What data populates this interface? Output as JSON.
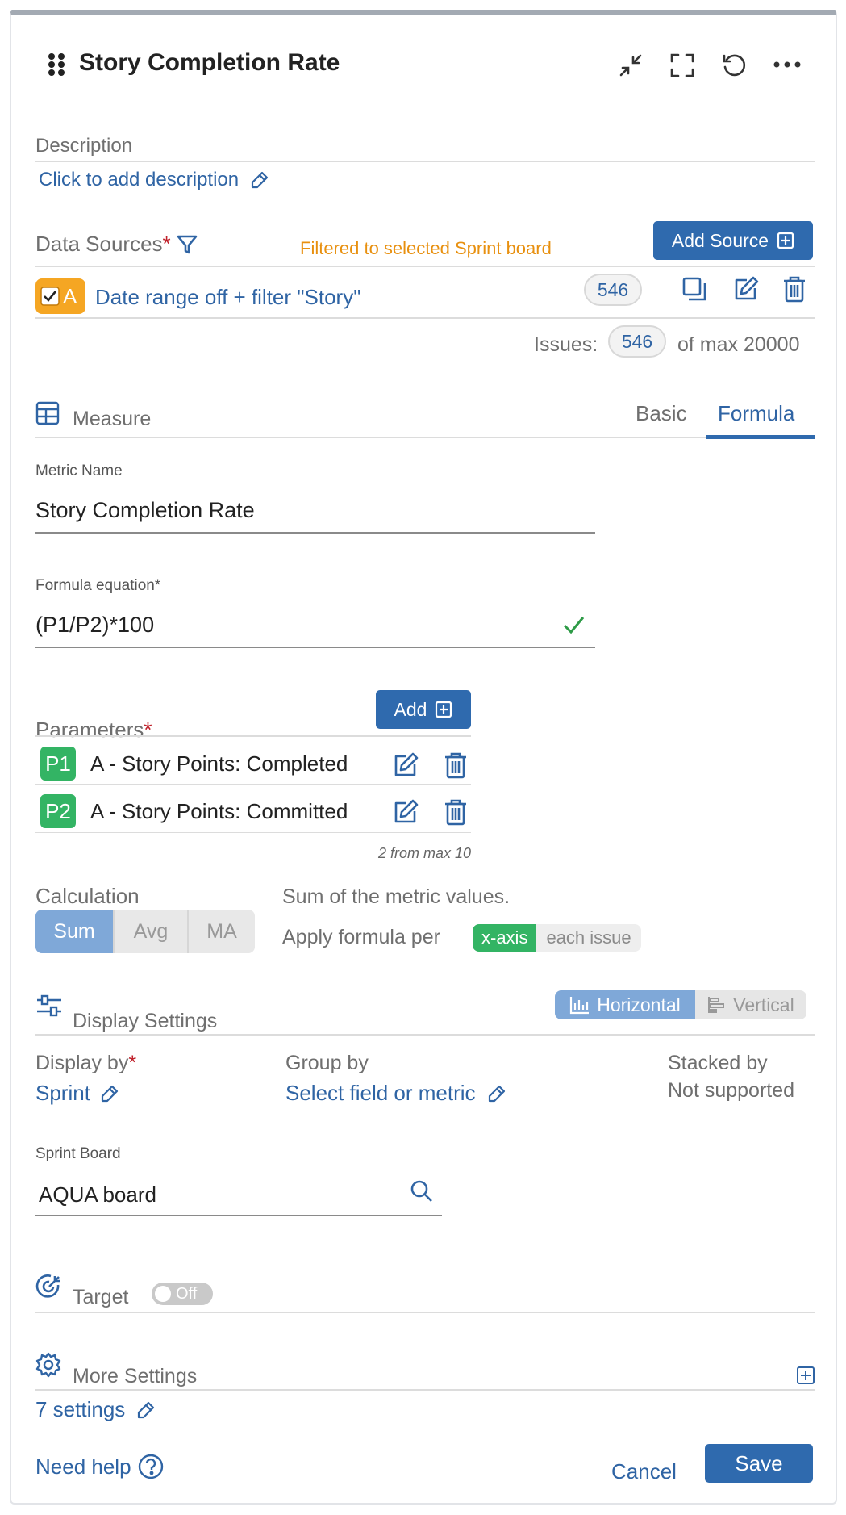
{
  "header": {
    "title": "Story Completion Rate"
  },
  "description": {
    "label": "Description",
    "link": "Click to add description"
  },
  "data_sources": {
    "label": "Data Sources",
    "required_mark": "*",
    "filter_note": "Filtered to selected Sprint board",
    "add_button": "Add Source",
    "source": {
      "badge_letter": "A",
      "label": "Date range off + filter \"Story\"",
      "count": "546"
    },
    "issues_label": "Issues:",
    "issues_count": "546",
    "issues_max": "of max 20000"
  },
  "measure": {
    "label": "Measure",
    "tabs": [
      {
        "label": "Basic"
      },
      {
        "label": "Formula"
      }
    ],
    "active_tab": "Formula",
    "metric_name_label": "Metric Name",
    "metric_name_value": "Story Completion Rate",
    "formula_label": "Formula equation*",
    "formula_value": "(P1/P2)*100"
  },
  "parameters": {
    "label": "Parameters",
    "required_mark": "*",
    "add_button": "Add",
    "items": [
      {
        "badge": "P1",
        "label": "A - Story Points: Completed"
      },
      {
        "badge": "P2",
        "label": "A - Story Points: Committed"
      }
    ],
    "count_note": "2 from max 10"
  },
  "calculation": {
    "label": "Calculation",
    "options": [
      {
        "label": "Sum"
      },
      {
        "label": "Avg"
      },
      {
        "label": "MA"
      }
    ],
    "selected": "Sum",
    "description": "Sum of the metric values.",
    "apply_label": "Apply formula per",
    "apply_options": [
      {
        "label": "x-axis"
      },
      {
        "label": "each issue"
      }
    ],
    "apply_selected": "x-axis"
  },
  "display_settings": {
    "label": "Display Settings",
    "orientation_options": [
      {
        "label": "Horizontal"
      },
      {
        "label": "Vertical"
      }
    ],
    "orientation_selected": "Horizontal",
    "display_by_label": "Display by",
    "required_mark": "*",
    "display_by_value": "Sprint",
    "group_by_label": "Group by",
    "group_by_value": "Select field or metric",
    "stacked_by_label": "Stacked by",
    "stacked_by_value": "Not supported",
    "sprint_board_label": "Sprint Board",
    "sprint_board_value": "AQUA board"
  },
  "target": {
    "label": "Target",
    "toggle": "Off"
  },
  "more_settings": {
    "label": "More Settings",
    "link": "7 settings"
  },
  "footer": {
    "help": "Need help",
    "cancel": "Cancel",
    "save": "Save"
  },
  "colors": {
    "accent": "#2f6aae",
    "green": "#33b464",
    "orange": "#f5a623",
    "required": "#c0202a",
    "filter_note": "#e8900f"
  }
}
